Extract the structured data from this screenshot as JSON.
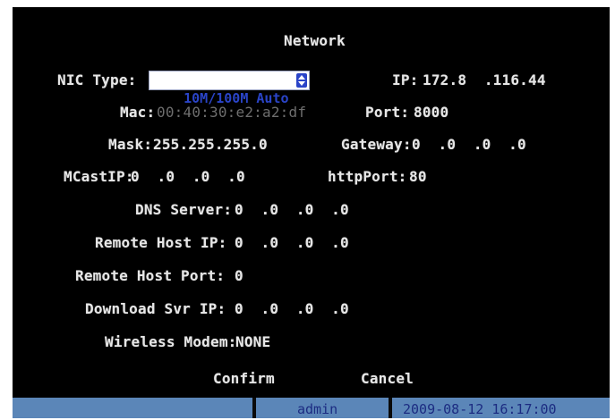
{
  "title": "Network",
  "nic": {
    "label": "NIC Type:",
    "value": "10M/100M Auto"
  },
  "ip": {
    "label": "IP:",
    "value": "172.8  .116.44"
  },
  "mac": {
    "label": "Mac:",
    "value": "00:40:30:e2:a2:df"
  },
  "port": {
    "label": "Port:",
    "value": "8000"
  },
  "mask": {
    "label": "Mask:",
    "value": "255.255.255.0"
  },
  "gateway": {
    "label": "Gateway:",
    "value": "0  .0  .0  .0"
  },
  "mcastip": {
    "label": "MCastIP:",
    "value": "0  .0  .0  .0"
  },
  "httpport": {
    "label": "httpPort:",
    "value": "80"
  },
  "dns": {
    "label": "DNS Server:",
    "value": "0  .0  .0  .0"
  },
  "remote_ip": {
    "label": "Remote Host IP:",
    "value": "0  .0  .0  .0"
  },
  "remote_port": {
    "label": "Remote Host Port:",
    "value": "0"
  },
  "download_ip": {
    "label": "Download Svr IP:",
    "value": "0  .0  .0  .0"
  },
  "wireless": {
    "label": "Wireless Modem:",
    "value": "NONE"
  },
  "buttons": {
    "confirm": "Confirm",
    "cancel": "Cancel"
  },
  "status": {
    "user": "admin",
    "datetime": "2009-08-12 16:17:00"
  },
  "colors": {
    "background": "#000000",
    "text": "#e6e6e6",
    "select_text": "#2a44c8",
    "statusbar": "#5b86b8"
  },
  "icons": {
    "select_arrow": "up-down-arrows-icon"
  }
}
